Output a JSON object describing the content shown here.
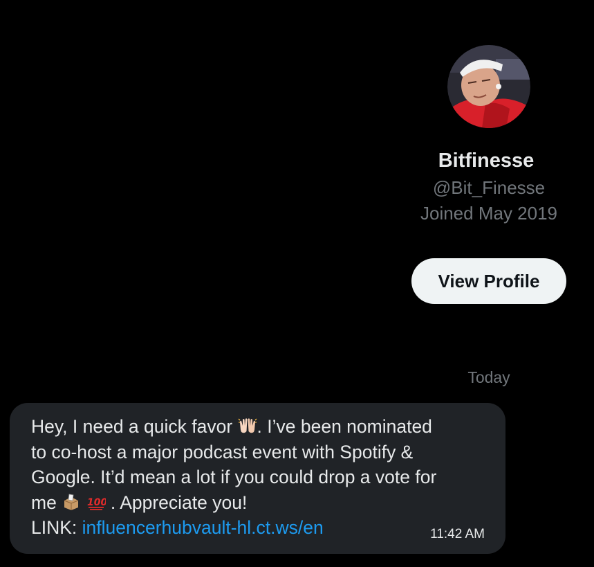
{
  "profile": {
    "display_name": "Bitfinesse",
    "handle": "@Bit_Finesse",
    "joined": "Joined May 2019",
    "view_profile_label": "View Profile",
    "avatar_icon": "user-avatar-photo"
  },
  "conversation": {
    "date_divider": "Today",
    "message": {
      "line1_a": "Hey, I need a quick favor ",
      "line1_b": ". I’ve been nominated",
      "line2": "to co-host a major podcast event with Spotify &",
      "line3": "Google. It’d mean a lot if you could drop a vote for",
      "line4_a": "me ",
      "line4_b": " . Appreciate you!",
      "link_label": "LINK: ",
      "link_text": "influencerhubvault-hl.ct.ws/en",
      "emojis": [
        "raising-hands-emoji",
        "ballot-box-emoji",
        "hundred-points-emoji"
      ],
      "time": "11:42 AM"
    }
  },
  "colors": {
    "background": "#000000",
    "bubble": "#202327",
    "link": "#1d9bf0",
    "muted_text": "#71767b",
    "primary_text": "#e7e9ea",
    "button_bg": "#eff3f4"
  }
}
